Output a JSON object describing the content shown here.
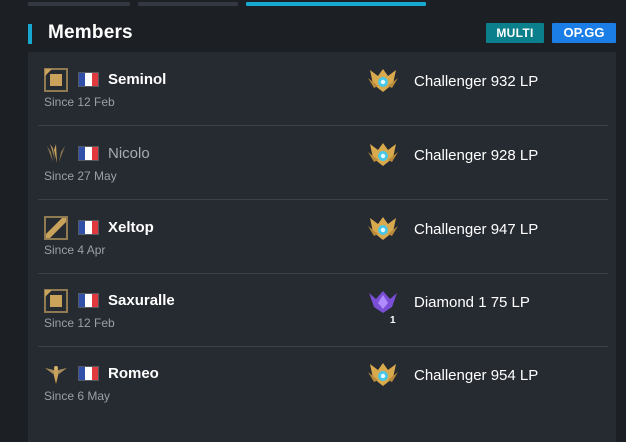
{
  "header": {
    "title": "Members",
    "multi_label": "MULTI",
    "opgg_label": "OP.GG"
  },
  "colors": {
    "accent": "#18a8cf",
    "multi_button": "#0b7f8c",
    "opgg_button": "#1a7ee6",
    "gold": "#c9a25c",
    "diamond": "#7a4fd6"
  },
  "members": [
    {
      "name": "Seminol",
      "since": "Since 12 Feb",
      "role_icon": "role-square-icon",
      "flag": "france-flag-icon",
      "rank_icon": "challenger-icon",
      "rank": "Challenger 932 LP"
    },
    {
      "name": "Nicolo",
      "since": "Since 27 May",
      "role_icon": "role-claw-icon",
      "flag": "france-flag-icon",
      "rank_icon": "challenger-icon",
      "rank": "Challenger 928 LP"
    },
    {
      "name": "Xeltop",
      "since": "Since 4 Apr",
      "role_icon": "role-diagonal-icon",
      "flag": "france-flag-icon",
      "rank_icon": "challenger-icon",
      "rank": "Challenger 947 LP"
    },
    {
      "name": "Saxuralle",
      "since": "Since 12 Feb",
      "role_icon": "role-square-icon",
      "flag": "france-flag-icon",
      "rank_icon": "diamond-icon",
      "rank_division": "1",
      "rank": "Diamond 1 75 LP"
    },
    {
      "name": "Romeo",
      "since": "Since 6 May",
      "role_icon": "role-support-icon",
      "flag": "france-flag-icon",
      "rank_icon": "challenger-icon",
      "rank": "Challenger 954 LP"
    }
  ]
}
